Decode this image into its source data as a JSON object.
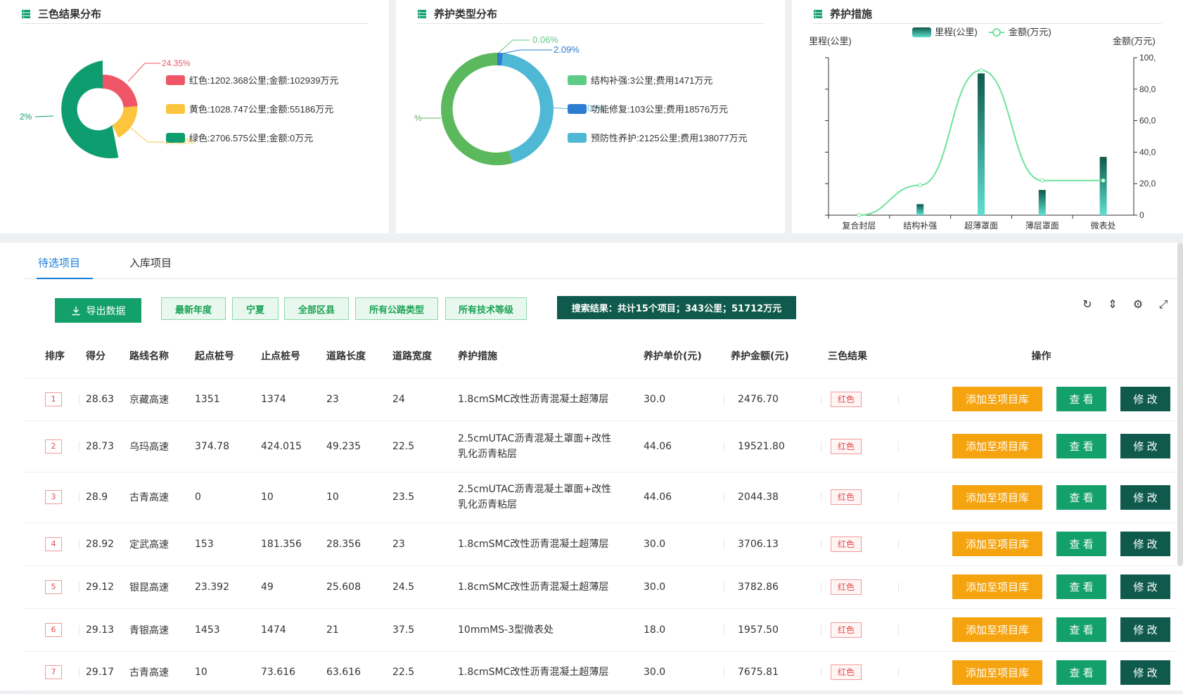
{
  "panels": {
    "three_color": {
      "title": "三色结果分布",
      "labels": {
        "pct_red": "24.35%",
        "pct_green_cut": "2%",
        "pct_yellow_cut": "20.83%",
        "legend_red": "红色:1202.368公里;金额:102939万元",
        "legend_yellow": "黄色:1028.747公里;金额:55186万元",
        "legend_green": "绿色:2706.575公里;金额:0万元"
      },
      "colors": {
        "red": "#ef5667",
        "yellow": "#fdc43d",
        "green": "#0e9d6e"
      }
    },
    "maint_type": {
      "title": "养护类型分布",
      "labels": {
        "pct_struct": "0.06%",
        "pct_func": "2.09%",
        "pct_left_cut": "%",
        "pct_overlap": "2.03%",
        "legend_struct": "结构补强:3公里;费用1471万元",
        "legend_func": "功能修复:103公里;费用18576万元",
        "legend_prev": "预防性养护:2125公里;费用138077万元"
      },
      "colors": {
        "struct": "#5ecb87",
        "func": "#2d7dd2",
        "prev": "#4fb8d4",
        "ring": "#5cb85c"
      }
    },
    "measures": {
      "title": "养护措施",
      "legend_bar": "里程(公里)",
      "legend_line": "金额(万元)",
      "ylabel_left": "里程(公里)",
      "ylabel_right": "金额(万元)"
    }
  },
  "chart_data": [
    {
      "type": "pie",
      "title": "三色结果分布",
      "categories": [
        "红色",
        "黄色",
        "绿色"
      ],
      "values": [
        1202.368,
        1028.747,
        2706.575
      ],
      "amounts": [
        102939,
        55186,
        0
      ]
    },
    {
      "type": "pie",
      "title": "养护类型分布",
      "categories": [
        "结构补强",
        "功能修复",
        "预防性养护"
      ],
      "values": [
        3,
        103,
        2125
      ],
      "amounts": [
        1471,
        18576,
        138077
      ]
    },
    {
      "type": "bar",
      "title": "养护措施",
      "categories": [
        "复合封层",
        "结构补强",
        "超薄罩面",
        "薄层罩面",
        "微表处"
      ],
      "series": [
        {
          "name": "里程(公里)",
          "values": [
            0,
            7,
            90,
            16,
            37
          ]
        },
        {
          "name": "金额(万元)",
          "values": [
            0,
            19,
            92,
            22,
            22
          ]
        }
      ],
      "right_ticks": [
        "0",
        "20,0",
        "40,0",
        "60,0",
        "80,0",
        "100,"
      ],
      "ylim": [
        0,
        100
      ]
    }
  ],
  "tabs": [
    "待选项目",
    "入库项目"
  ],
  "toolbar": {
    "export": "导出数据",
    "chips": [
      "最新年度",
      "宁夏",
      "全部区县",
      "所有公路类型",
      "所有技术等级"
    ],
    "result": "搜索结果：共计15个项目；343公里；51712万元"
  },
  "table": {
    "headers": [
      "排序",
      "得分",
      "路线名称",
      "起点桩号",
      "止点桩号",
      "道路长度",
      "道路宽度",
      "养护措施",
      "养护单价(元)",
      "养护金额(元)",
      "三色结果",
      "操作"
    ],
    "rows": [
      [
        "1",
        "28.63",
        "京藏高速",
        "1351",
        "1374",
        "23",
        "24",
        "1.8cmSMC改性沥青混凝土超薄层",
        "30.0",
        "2476.70",
        "红色"
      ],
      [
        "2",
        "28.73",
        "乌玛高速",
        "374.78",
        "424.015",
        "49.235",
        "22.5",
        "2.5cmUTAC沥青混凝土罩面+改性乳化沥青粘层",
        "44.06",
        "19521.80",
        "红色"
      ],
      [
        "3",
        "28.9",
        "古青高速",
        "0",
        "10",
        "10",
        "23.5",
        "2.5cmUTAC沥青混凝土罩面+改性乳化沥青粘层",
        "44.06",
        "2044.38",
        "红色"
      ],
      [
        "4",
        "28.92",
        "定武高速",
        "153",
        "181.356",
        "28.356",
        "23",
        "1.8cmSMC改性沥青混凝土超薄层",
        "30.0",
        "3706.13",
        "红色"
      ],
      [
        "5",
        "29.12",
        "银昆高速",
        "23.392",
        "49",
        "25.608",
        "24.5",
        "1.8cmSMC改性沥青混凝土超薄层",
        "30.0",
        "3782.86",
        "红色"
      ],
      [
        "6",
        "29.13",
        "青银高速",
        "1453",
        "1474",
        "21",
        "37.5",
        "10mmMS-3型微表处",
        "18.0",
        "1957.50",
        "红色"
      ],
      [
        "7",
        "29.17",
        "古青高速",
        "10",
        "73.616",
        "63.616",
        "22.5",
        "1.8cmSMC改性沥青混凝土超薄层",
        "30.0",
        "7675.81",
        "红色"
      ]
    ],
    "actions": {
      "add": "添加至项目库",
      "view": "查 看",
      "edit": "修 改"
    }
  }
}
